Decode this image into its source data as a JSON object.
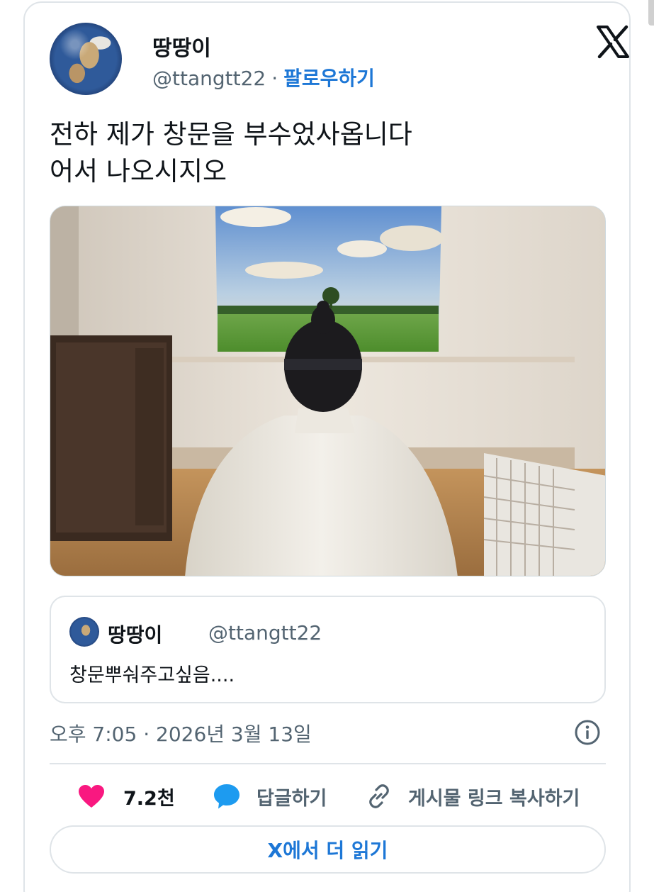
{
  "author": {
    "name": "땅땅이",
    "handle": "@ttangtt22",
    "separator": "·",
    "follow_label": "팔로우하기"
  },
  "icons": {
    "platform": "x-logo-icon",
    "info": "info-icon",
    "like": "heart-icon",
    "reply": "speech-bubble-icon",
    "copy": "link-icon"
  },
  "tweet": {
    "lines": [
      "전하 제가 창문을 부수었사옵니다",
      "어서 나오시지오"
    ]
  },
  "quote": {
    "name": "땅땅이",
    "handle": "@ttangtt22",
    "text": "창문뿌숴주고싶음...."
  },
  "meta": {
    "timestamp": "오후 7:05 · 2026년 3월 13일"
  },
  "actions": {
    "like_count": "7.2천",
    "reply_label": "답글하기",
    "copy_label": "게시물 링크 복사하기"
  },
  "read_more_label": "X에서 더 읽기",
  "colors": {
    "accent": "#1d77d6",
    "like": "#f91880",
    "text": "#0f1419",
    "muted": "#536471",
    "border": "#dfe4e8"
  }
}
